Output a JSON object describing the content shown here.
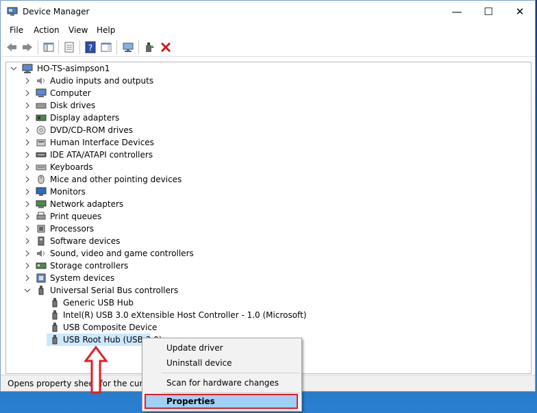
{
  "window": {
    "title": "Device Manager",
    "minimize": "—",
    "maximize": "☐",
    "close": "✕"
  },
  "menu": [
    "File",
    "Action",
    "View",
    "Help"
  ],
  "tree": {
    "root": "HO-TS-asimpson1",
    "categories": [
      {
        "label": "Audio inputs and outputs",
        "icon": "speaker-icon"
      },
      {
        "label": "Computer",
        "icon": "computer-icon"
      },
      {
        "label": "Disk drives",
        "icon": "disk-drive-icon"
      },
      {
        "label": "Display adapters",
        "icon": "display-adapter-icon"
      },
      {
        "label": "DVD/CD-ROM drives",
        "icon": "dvd-drive-icon"
      },
      {
        "label": "Human Interface Devices",
        "icon": "hid-icon"
      },
      {
        "label": "IDE ATA/ATAPI controllers",
        "icon": "ide-controller-icon"
      },
      {
        "label": "Keyboards",
        "icon": "keyboard-icon"
      },
      {
        "label": "Mice and other pointing devices",
        "icon": "mouse-icon"
      },
      {
        "label": "Monitors",
        "icon": "monitor-icon"
      },
      {
        "label": "Network adapters",
        "icon": "network-adapter-icon"
      },
      {
        "label": "Print queues",
        "icon": "printer-icon"
      },
      {
        "label": "Processors",
        "icon": "processor-icon"
      },
      {
        "label": "Software devices",
        "icon": "software-device-icon"
      },
      {
        "label": "Sound, video and game controllers",
        "icon": "sound-icon"
      },
      {
        "label": "Storage controllers",
        "icon": "storage-controller-icon"
      },
      {
        "label": "System devices",
        "icon": "system-device-icon"
      },
      {
        "label": "Universal Serial Bus controllers",
        "icon": "usb-icon"
      }
    ],
    "usb_children": [
      "Generic USB Hub",
      "Intel(R) USB 3.0 eXtensible Host Controller - 1.0 (Microsoft)",
      "USB Composite Device",
      "USB Root Hub (USB 3.0)"
    ]
  },
  "status": "Opens property sheet for the current s",
  "context_menu": {
    "update_driver": "Update driver",
    "uninstall_device": "Uninstall device",
    "scan": "Scan for hardware changes",
    "properties": "Properties"
  },
  "colors": {
    "selection": "#cce8ff",
    "highlight_border": "#e01e26",
    "properties_bg": "#9fd0f5"
  }
}
